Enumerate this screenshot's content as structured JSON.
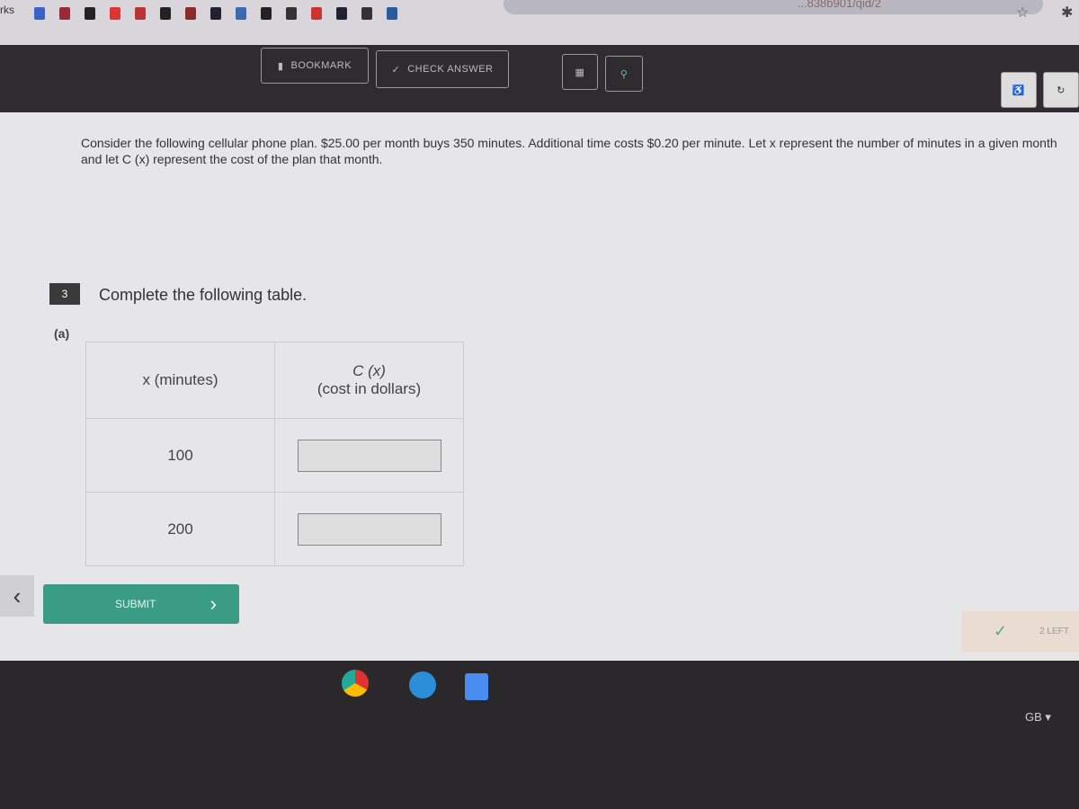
{
  "browser": {
    "bookmarks_label": "rks",
    "url_fragment": "...838b901/qid/2",
    "favicon_colors": [
      "#3b62c9",
      "#9a2a3a",
      "#222",
      "#d33",
      "#b33",
      "#222",
      "#8a2a2a",
      "#223",
      "#3a6ab0",
      "#222",
      "#333",
      "#c33",
      "#223",
      "#333",
      "#2a5aa0"
    ]
  },
  "toolbar": {
    "bookmark_label": "BOOKMARK",
    "check_answer_label": "CHECK ANSWER"
  },
  "question": {
    "text": "Consider the following cellular phone plan. $25.00 per month buys 350 minutes. Additional time costs $0.20 per minute. Let x represent the number of minutes in a given month and let C (x) represent the cost of the plan that month.",
    "number": "3",
    "instruction": "Complete the following table.",
    "part": "(a)"
  },
  "table": {
    "headers": [
      "x (minutes)",
      "C (x)",
      "(cost in dollars)"
    ],
    "rows": [
      {
        "x": "100",
        "cost": ""
      },
      {
        "x": "200",
        "cost": ""
      }
    ]
  },
  "submit_label": "SUBMIT",
  "status": {
    "tries_left": "2 LEFT"
  },
  "system": {
    "keyboard": "GB"
  },
  "colors": {
    "accent": "#3a9c84",
    "toolbar": "#2e2c2f"
  }
}
